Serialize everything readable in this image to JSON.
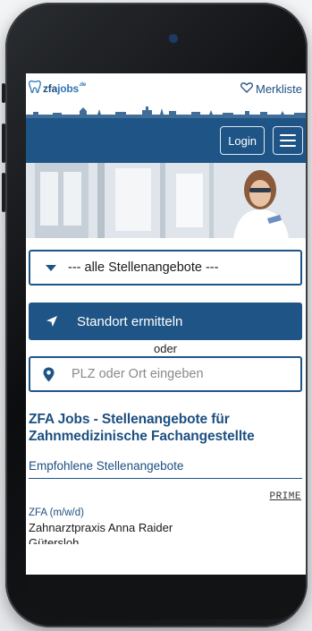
{
  "header": {
    "logo_text_zfa": "zfa",
    "logo_text_jobs": "jobs",
    "logo_sup": ".de",
    "wishlist_label": "Merkliste"
  },
  "nav": {
    "login_label": "Login"
  },
  "search": {
    "category_select": "--- alle Stellenangebote ---",
    "locate_button": "Standort ermitteln",
    "or_label": "oder",
    "zip_placeholder": "PLZ oder Ort eingeben"
  },
  "main": {
    "headline": "ZFA Jobs - Stellenangebote für Zahnmedizinische Fachangestellte",
    "recommended_title": "Empfohlene Stellenangebote"
  },
  "jobs": [
    {
      "badge": "PRIME",
      "title": "ZFA (m/w/d)",
      "practice": "Zahnarztpraxis Anna Raider",
      "city": "Gütersloh"
    }
  ],
  "colors": {
    "brand_blue": "#1f5586",
    "text_blue": "#1d4f80"
  },
  "icons": [
    "tooth-logo-icon",
    "heart-icon",
    "hamburger-icon",
    "caret-down-icon",
    "location-arrow-icon",
    "map-pin-icon"
  ]
}
